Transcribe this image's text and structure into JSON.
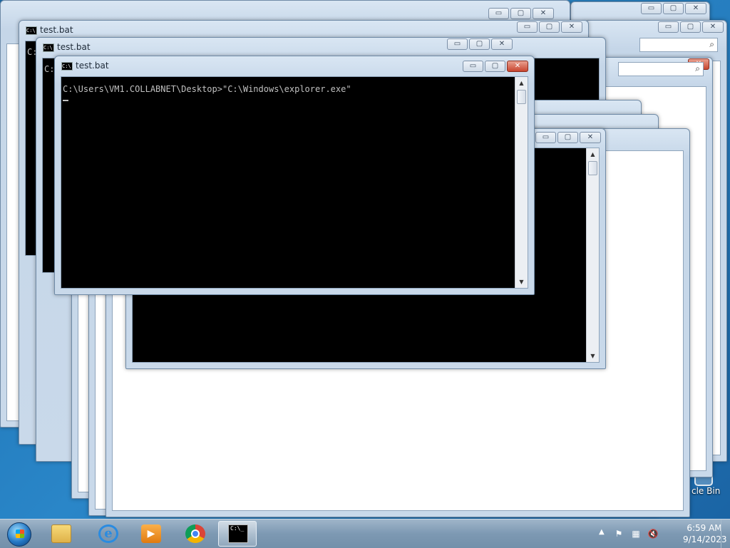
{
  "desktop": {
    "recycle_bin_label": "cle Bin"
  },
  "windows": {
    "back_title": "test.bat",
    "mid_title": "test.bat",
    "front_title": "test.bat",
    "back_console_prefix": "C:",
    "mid_console_prefix": "C:",
    "icon_text": "C:\\",
    "min_glyph": "▭",
    "max_glyph": "▢",
    "close_glyph": "✕"
  },
  "console": {
    "command_line": "C:\\Users\\VM1.COLLABNET\\Desktop>\"C:\\Windows\\explorer.exe\""
  },
  "search": {
    "icon": "search-icon",
    "glyph": "⌕"
  },
  "taskbar": {
    "pinned": [
      {
        "name": "windows-explorer",
        "icon": "folder-icon"
      },
      {
        "name": "internet-explorer",
        "icon": "ie-icon",
        "glyph": "e"
      },
      {
        "name": "media-player",
        "icon": "media-icon",
        "glyph": "▶"
      },
      {
        "name": "chrome",
        "icon": "chrome-icon"
      },
      {
        "name": "command-prompt",
        "icon": "cmd-icon",
        "glyph": "C:\\_"
      }
    ],
    "tray": {
      "arrow": "▲",
      "flag_glyph": "⚑",
      "network_glyph": "▦",
      "volume_glyph": "🔇"
    },
    "clock": {
      "time": "6:59 AM",
      "date": "9/14/2023"
    }
  },
  "colors": {
    "console_text": "#c0c0c0",
    "close_button": "#c8452f",
    "desktop_blue": "#1a6fb0"
  }
}
